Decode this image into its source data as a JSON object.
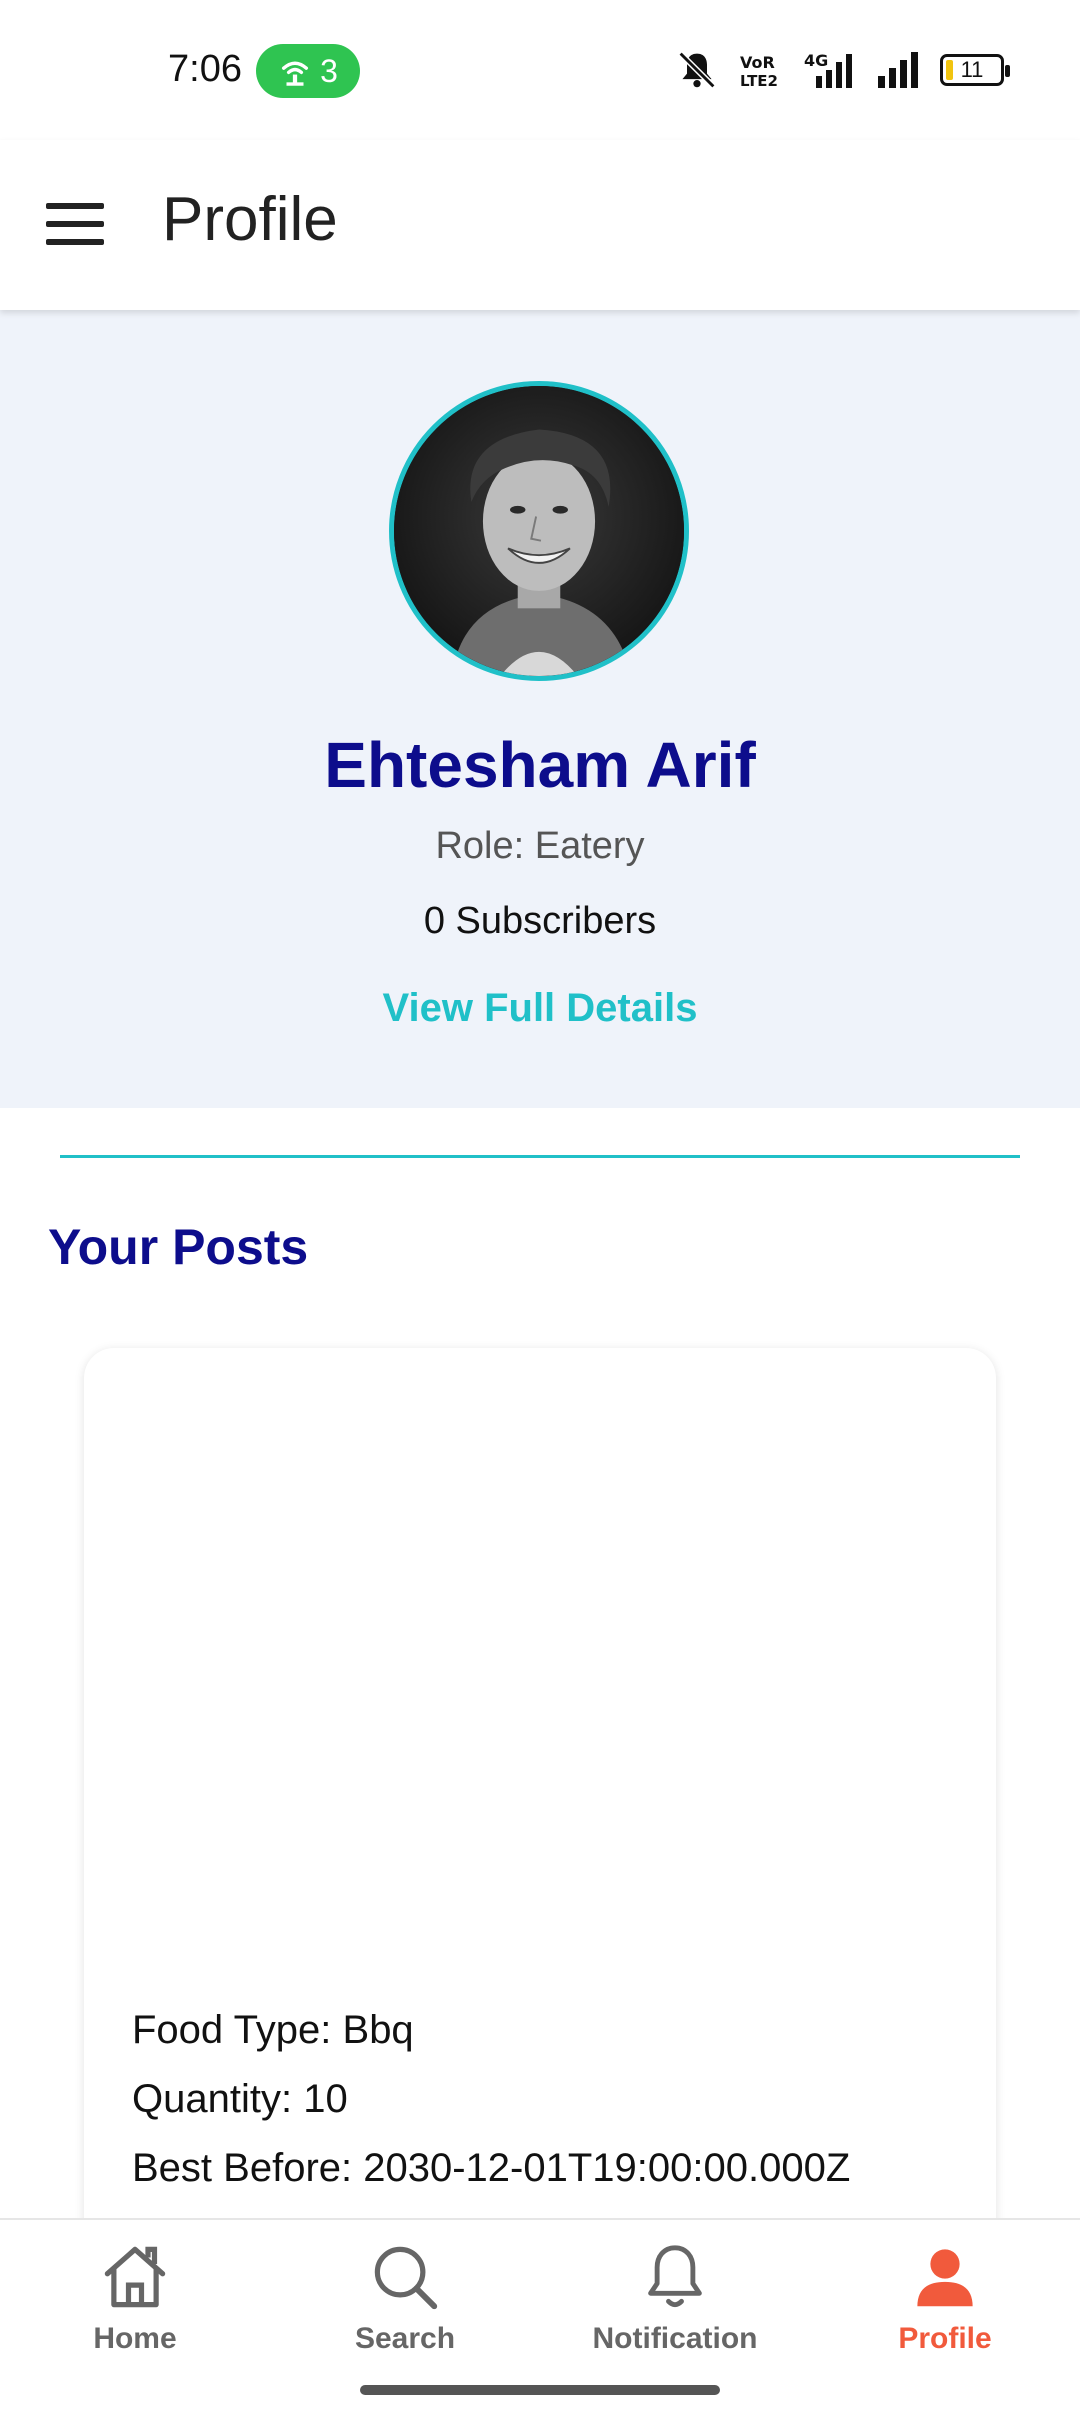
{
  "status_bar": {
    "time": "7:06",
    "hotspot_count": "3",
    "battery_level": "11",
    "hotspot_color": "#2fc451"
  },
  "app_bar": {
    "title": "Profile",
    "menu_icon": "hamburger-menu-icon"
  },
  "profile": {
    "name": "Ehtesham Arif",
    "role": "Role: Eatery",
    "subscribers": "0 Subscribers",
    "view_details_label": "View Full Details",
    "accent_color": "#20c0c8",
    "name_color": "#0d0d8c"
  },
  "posts": {
    "section_title": "Your Posts",
    "items": [
      {
        "food_type": "Food Type: Bbq",
        "quantity": "Quantity: 10",
        "best_before": "Best Before: 2030-12-01T19:00:00.000Z"
      }
    ]
  },
  "bottom_nav": {
    "items": [
      {
        "label": "Home",
        "icon": "home-icon"
      },
      {
        "label": "Search",
        "icon": "search-icon"
      },
      {
        "label": "Notification",
        "icon": "bell-icon"
      },
      {
        "label": "Profile",
        "icon": "person-icon",
        "active": true
      }
    ],
    "active_color": "#f15a3c"
  }
}
